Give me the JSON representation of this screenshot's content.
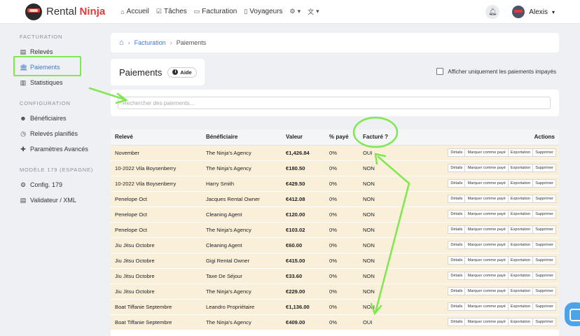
{
  "app": {
    "logo_word1": "Rental",
    "logo_word2": "Ninja",
    "nav": [
      {
        "label": "Accueil",
        "icon": "home-icon"
      },
      {
        "label": "Tâches",
        "icon": "check-square-icon"
      },
      {
        "label": "Facturation",
        "icon": "money-icon"
      },
      {
        "label": "Voyageurs",
        "icon": "suitcase-icon"
      }
    ],
    "user_name": "Alexis"
  },
  "sidebar": {
    "section1": "FACTURATION",
    "items1": [
      "Relevés",
      "Paiements",
      "Statistiques"
    ],
    "section2": "CONFIGURATION",
    "items2": [
      "Bénéficiaires",
      "Relevés planifiés",
      "Paramètres Avancés"
    ],
    "section3": "MODÈLE 179 (ESPAGNE)",
    "items3": [
      "Config. 179",
      "Validateur / XML"
    ]
  },
  "breadcrumb": [
    "Facturation",
    "Paiements"
  ],
  "page": {
    "title": "Paiements",
    "help": "Aide",
    "unpaid_only": "Afficher uniquement les paiements impayés",
    "search_placeholder": "Rechercher des paiements..."
  },
  "table": {
    "headers": [
      "Relevé",
      "Bénéficiaire",
      "Valeur",
      "% payé",
      "Facturé ?",
      "Actions"
    ],
    "actions": [
      "Détails",
      "Marquer comme payé",
      "Exportation",
      "Supprimer"
    ],
    "rows": [
      [
        "November",
        "The Ninja's Agency",
        "€1,426.84",
        "0%",
        "OUI"
      ],
      [
        "10-2022 Vila Boysenberry",
        "The Ninja's Agency",
        "€180.50",
        "0%",
        "NON"
      ],
      [
        "10-2022 Vila Boysenberry",
        "Harry Smith",
        "€429.50",
        "0%",
        "NON"
      ],
      [
        "Penelope Oct",
        "Jacques Rental Owner",
        "€412.08",
        "0%",
        "NON"
      ],
      [
        "Penelope Oct",
        "Cleaning Agent",
        "€120.00",
        "0%",
        "NON"
      ],
      [
        "Penelope Oct",
        "The Ninja's Agency",
        "€103.02",
        "0%",
        "NON"
      ],
      [
        "Jiu Jitsu Octobre",
        "Cleaning Agent",
        "€60.00",
        "0%",
        "NON"
      ],
      [
        "Jiu Jitsu Octobre",
        "Gigi Rental Owner",
        "€415.00",
        "0%",
        "NON"
      ],
      [
        "Jiu Jitsu Octobre",
        "Taxe De Séjour",
        "€33.60",
        "0%",
        "NON"
      ],
      [
        "Jiu Jitsu Octobre",
        "The Ninja's Agency",
        "€229.00",
        "0%",
        "NON"
      ],
      [
        "Boat Tiffanie Septembre",
        "Leandro Propriétaire",
        "€1,136.00",
        "0%",
        "NON"
      ],
      [
        "Boat Tiffanie Septembre",
        "The Ninja's Agency",
        "€409.00",
        "0%",
        "OUI"
      ]
    ]
  },
  "colors": {
    "accent": "#3a7bd5",
    "row_bg": "#faefd8",
    "annotation": "#7ee84e",
    "brand_red": "#e23a3a"
  }
}
